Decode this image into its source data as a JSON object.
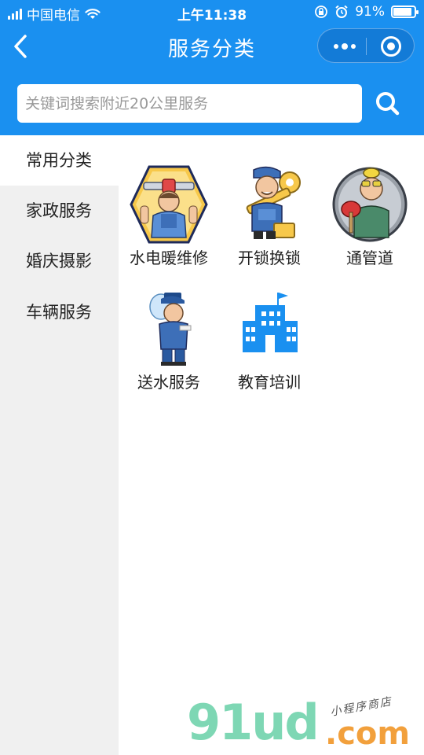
{
  "status_bar": {
    "carrier": "中国电信",
    "time": "上午11:38",
    "battery_percent": "91%",
    "battery_level": 0.91
  },
  "nav": {
    "title": "服务分类"
  },
  "search": {
    "placeholder": "关键词搜索附近20公里服务"
  },
  "sidebar": {
    "items": [
      {
        "label": "常用分类",
        "active": true
      },
      {
        "label": "家政服务",
        "active": false
      },
      {
        "label": "婚庆摄影",
        "active": false
      },
      {
        "label": "车辆服务",
        "active": false
      }
    ]
  },
  "categories": [
    {
      "label": "水电暖维修",
      "icon": "plumber-icon"
    },
    {
      "label": "开锁换锁",
      "icon": "locksmith-icon"
    },
    {
      "label": "通管道",
      "icon": "pipe-unclog-icon"
    },
    {
      "label": "送水服务",
      "icon": "water-delivery-icon"
    },
    {
      "label": "教育培训",
      "icon": "school-building-icon"
    }
  ],
  "watermark": {
    "brand": "91ud",
    "suffix": ".com",
    "tagline": "小程序商店"
  },
  "colors": {
    "primary": "#1a90f0",
    "sidebar_bg": "#f0f0f0"
  }
}
